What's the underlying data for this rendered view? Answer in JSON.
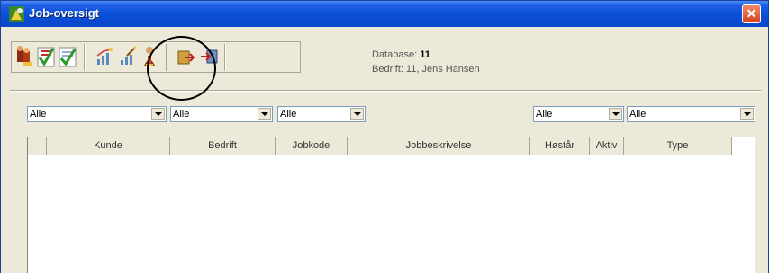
{
  "window": {
    "title": "Job-oversigt",
    "close_glyph": "✕"
  },
  "toolbar": {
    "buttons": [
      {
        "icon": "people-icon"
      },
      {
        "icon": "checklist-red-icon"
      },
      {
        "icon": "checklist-green-icon"
      },
      {
        "icon": "chart-icon"
      },
      {
        "icon": "chart-edit-icon"
      },
      {
        "icon": "person-edit-icon"
      },
      {
        "icon": "export-icon"
      },
      {
        "icon": "import-icon"
      }
    ]
  },
  "info": {
    "database_label": "Database:",
    "database_value": "11",
    "company_label": "Bedrift:",
    "company_value": "11, Jens Hansen"
  },
  "filters": {
    "filter1": "Alle",
    "filter2": "Alle",
    "filter3": "Alle",
    "filter4": "Alle",
    "filter5": "Alle"
  },
  "table": {
    "columns": [
      "Kunde",
      "Bedrift",
      "Jobkode",
      "Jobbeskrivelse",
      "Høstår",
      "Aktiv",
      "Type"
    ]
  },
  "colors": {
    "title_bar": "#0a4ed8",
    "window_bg": "#ece9d8",
    "close_button": "#d8401c"
  }
}
